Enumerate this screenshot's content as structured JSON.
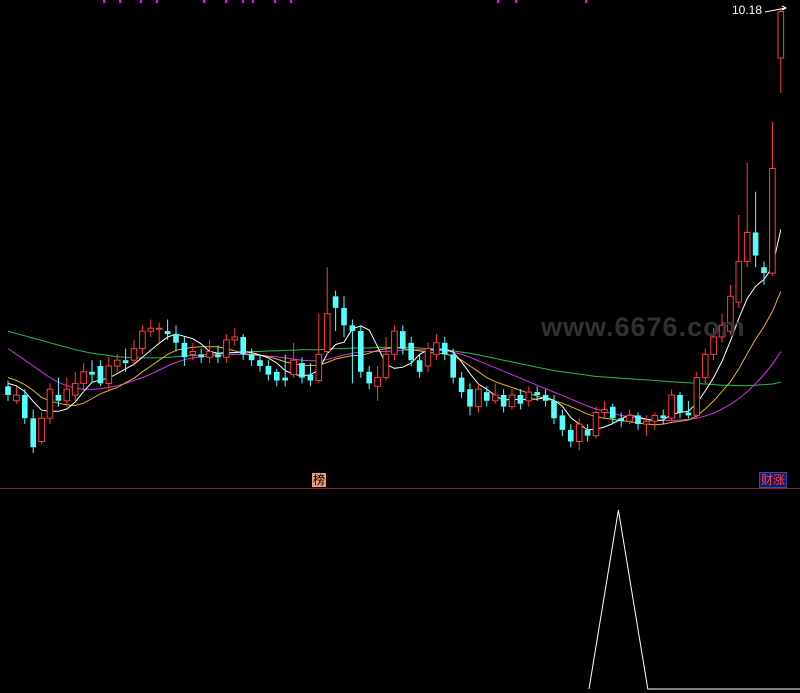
{
  "price_label": "10.18",
  "watermark": "www.6676.com",
  "tags": {
    "top_left": "榜",
    "top_right": "财涨"
  },
  "colors": {
    "background": "#000000",
    "up": "#ff3c3c",
    "down": "#54ffff",
    "ma_white": "#ffffff",
    "ma_yellow": "#e6b422",
    "ma_magenta": "#d632e6",
    "ma_green": "#2fb84f",
    "divider": "#8b1a1a",
    "top_marks": "#ff00ff"
  },
  "chart_data": [
    {
      "type": "candlestick",
      "title": "",
      "ylim": [
        2.2,
        10.6
      ],
      "y_axis_labels": [
        "10.18"
      ],
      "candles": [
        [
          3.95,
          3.8,
          4.05,
          3.7
        ],
        [
          3.7,
          3.8,
          3.95,
          3.65
        ],
        [
          3.8,
          3.4,
          3.9,
          3.3
        ],
        [
          3.4,
          2.9,
          3.55,
          2.8
        ],
        [
          3.0,
          3.4,
          3.5,
          2.95
        ],
        [
          3.4,
          3.9,
          4.0,
          3.3
        ],
        [
          3.8,
          3.7,
          4.1,
          3.6
        ],
        [
          3.7,
          3.9,
          4.1,
          3.6
        ],
        [
          3.8,
          4.0,
          4.2,
          3.7
        ],
        [
          4.0,
          4.2,
          4.35,
          3.85
        ],
        [
          4.2,
          4.15,
          4.4,
          4.0
        ],
        [
          4.3,
          4.0,
          4.4,
          3.95
        ],
        [
          4.0,
          4.3,
          4.45,
          3.9
        ],
        [
          4.3,
          4.4,
          4.5,
          4.2
        ],
        [
          4.4,
          4.35,
          4.6,
          4.2
        ],
        [
          4.4,
          4.6,
          4.75,
          4.3
        ],
        [
          4.6,
          4.9,
          5.0,
          4.5
        ],
        [
          4.9,
          4.95,
          5.1,
          4.8
        ],
        [
          4.95,
          4.95,
          5.05,
          4.7
        ],
        [
          4.9,
          4.85,
          5.1,
          4.75
        ],
        [
          4.85,
          4.7,
          5.0,
          4.55
        ],
        [
          4.7,
          4.45,
          4.8,
          4.3
        ],
        [
          4.5,
          4.55,
          4.7,
          4.4
        ],
        [
          4.5,
          4.45,
          4.6,
          4.35
        ],
        [
          4.45,
          4.55,
          4.75,
          4.35
        ],
        [
          4.5,
          4.45,
          4.65,
          4.35
        ],
        [
          4.45,
          4.75,
          4.85,
          4.35
        ],
        [
          4.75,
          4.8,
          4.95,
          4.65
        ],
        [
          4.8,
          4.5,
          4.85,
          4.4
        ],
        [
          4.5,
          4.4,
          4.6,
          4.3
        ],
        [
          4.4,
          4.3,
          4.5,
          4.2
        ],
        [
          4.3,
          4.15,
          4.4,
          4.05
        ],
        [
          4.2,
          4.05,
          4.25,
          3.95
        ],
        [
          4.1,
          4.05,
          4.5,
          3.95
        ],
        [
          4.15,
          4.4,
          4.7,
          4.1
        ],
        [
          4.35,
          4.1,
          4.45,
          4.0
        ],
        [
          4.15,
          4.05,
          4.35,
          3.95
        ],
        [
          4.05,
          4.5,
          5.2,
          4.0
        ],
        [
          4.55,
          5.2,
          6.0,
          4.5
        ],
        [
          5.5,
          5.3,
          5.6,
          4.9
        ],
        [
          5.3,
          5.0,
          5.5,
          4.8
        ],
        [
          5.0,
          4.9,
          5.1,
          4.0
        ],
        [
          4.9,
          4.2,
          5.0,
          4.1
        ],
        [
          4.2,
          4.0,
          4.3,
          3.9
        ],
        [
          3.95,
          4.1,
          4.3,
          3.7
        ],
        [
          4.1,
          4.5,
          4.8,
          4.05
        ],
        [
          4.5,
          4.9,
          5.0,
          4.4
        ],
        [
          4.9,
          4.6,
          5.0,
          4.5
        ],
        [
          4.7,
          4.4,
          4.8,
          4.3
        ],
        [
          4.4,
          4.2,
          4.5,
          4.1
        ],
        [
          4.3,
          4.6,
          4.7,
          4.2
        ],
        [
          4.5,
          4.7,
          4.85,
          4.4
        ],
        [
          4.7,
          4.5,
          4.8,
          4.4
        ],
        [
          4.5,
          4.1,
          4.6,
          4.0
        ],
        [
          4.1,
          3.85,
          4.2,
          3.75
        ],
        [
          3.9,
          3.6,
          4.0,
          3.45
        ],
        [
          3.6,
          3.9,
          4.0,
          3.5
        ],
        [
          3.85,
          3.7,
          3.95,
          3.6
        ],
        [
          3.7,
          3.8,
          4.0,
          3.65
        ],
        [
          3.8,
          3.6,
          3.9,
          3.5
        ],
        [
          3.6,
          3.8,
          3.9,
          3.55
        ],
        [
          3.8,
          3.65,
          3.9,
          3.55
        ],
        [
          3.7,
          3.85,
          3.95,
          3.6
        ],
        [
          3.85,
          3.8,
          3.95,
          3.7
        ],
        [
          3.8,
          3.7,
          3.9,
          3.6
        ],
        [
          3.7,
          3.4,
          3.8,
          3.3
        ],
        [
          3.45,
          3.2,
          3.55,
          3.1
        ],
        [
          3.2,
          3.0,
          3.3,
          2.9
        ],
        [
          3.0,
          3.3,
          3.4,
          2.85
        ],
        [
          3.2,
          3.1,
          3.3,
          3.0
        ],
        [
          3.1,
          3.5,
          3.6,
          3.05
        ],
        [
          3.5,
          3.55,
          3.7,
          3.4
        ],
        [
          3.6,
          3.4,
          3.65,
          3.3
        ],
        [
          3.4,
          3.35,
          3.5,
          3.25
        ],
        [
          3.35,
          3.45,
          3.55,
          3.3
        ],
        [
          3.45,
          3.3,
          3.5,
          3.2
        ],
        [
          3.3,
          3.35,
          3.45,
          3.1
        ],
        [
          3.35,
          3.45,
          3.5,
          3.2
        ],
        [
          3.45,
          3.4,
          3.55,
          3.3
        ],
        [
          3.4,
          3.8,
          3.9,
          3.35
        ],
        [
          3.8,
          3.5,
          3.85,
          3.4
        ],
        [
          3.5,
          3.45,
          3.7,
          3.4
        ],
        [
          3.45,
          4.1,
          4.2,
          3.4
        ],
        [
          4.1,
          4.5,
          4.6,
          4.0
        ],
        [
          4.5,
          4.8,
          4.95,
          4.4
        ],
        [
          4.8,
          5.0,
          5.2,
          4.7
        ],
        [
          4.9,
          5.5,
          5.7,
          4.85
        ],
        [
          5.4,
          6.1,
          6.9,
          5.3
        ],
        [
          6.1,
          6.6,
          7.8,
          6.0
        ],
        [
          6.6,
          6.2,
          7.3,
          6.0
        ],
        [
          6.0,
          5.9,
          6.1,
          5.7
        ],
        [
          5.9,
          7.7,
          8.5,
          5.85
        ],
        [
          9.6,
          10.4,
          10.45,
          9.0
        ]
      ],
      "ma_lines": [
        {
          "color_key": "ma_white",
          "values": [
            4.0,
            3.96,
            3.86,
            3.69,
            3.54,
            3.52,
            3.52,
            3.56,
            3.68,
            3.86,
            4.02,
            4.06,
            4.09,
            4.17,
            4.25,
            4.33,
            4.45,
            4.57,
            4.69,
            4.8,
            4.85,
            4.81,
            4.77,
            4.68,
            4.55,
            4.52,
            4.53,
            4.53,
            4.55,
            4.53,
            4.49,
            4.44,
            4.35,
            4.22,
            4.16,
            4.13,
            4.15,
            4.23,
            4.51,
            4.67,
            4.71,
            4.94,
            4.99,
            4.92,
            4.63,
            4.33,
            4.26,
            4.28,
            4.35,
            4.5,
            4.58,
            4.58,
            4.6,
            4.54,
            4.37,
            4.17,
            3.99,
            3.9,
            3.79,
            3.71,
            3.73,
            3.72,
            3.73,
            3.73,
            3.76,
            3.71,
            3.61,
            3.41,
            3.3,
            3.2,
            3.21,
            3.25,
            3.31,
            3.39,
            3.46,
            3.42,
            3.38,
            3.36,
            3.37,
            3.47,
            3.5,
            3.52,
            3.66,
            3.87,
            4.1,
            4.38,
            4.73,
            5.12,
            5.46,
            5.67,
            5.79,
            6.0,
            6.65
          ]
        },
        {
          "color_key": "ma_yellow",
          "values": [
            4.1,
            4.05,
            3.98,
            3.88,
            3.76,
            3.7,
            3.66,
            3.63,
            3.62,
            3.66,
            3.74,
            3.82,
            3.88,
            3.93,
            4.01,
            4.09,
            4.2,
            4.3,
            4.4,
            4.5,
            4.57,
            4.6,
            4.62,
            4.63,
            4.63,
            4.63,
            4.6,
            4.56,
            4.51,
            4.5,
            4.49,
            4.46,
            4.42,
            4.37,
            4.34,
            4.31,
            4.31,
            4.31,
            4.36,
            4.42,
            4.45,
            4.48,
            4.48,
            4.52,
            4.57,
            4.6,
            4.62,
            4.6,
            4.58,
            4.56,
            4.54,
            4.52,
            4.51,
            4.47,
            4.4,
            4.3,
            4.2,
            4.1,
            4.03,
            3.98,
            3.93,
            3.88,
            3.83,
            3.78,
            3.74,
            3.7,
            3.66,
            3.6,
            3.54,
            3.47,
            3.43,
            3.4,
            3.38,
            3.36,
            3.34,
            3.32,
            3.3,
            3.29,
            3.3,
            3.33,
            3.35,
            3.37,
            3.44,
            3.56,
            3.7,
            3.86,
            4.03,
            4.25,
            4.51,
            4.76,
            4.98,
            5.24,
            5.58
          ]
        },
        {
          "color_key": "ma_magenta",
          "values": [
            4.6,
            4.5,
            4.4,
            4.3,
            4.2,
            4.1,
            4.02,
            3.96,
            3.92,
            3.9,
            3.9,
            3.91,
            3.93,
            3.96,
            4.0,
            4.05,
            4.1,
            4.16,
            4.23,
            4.3,
            4.36,
            4.41,
            4.44,
            4.46,
            4.47,
            4.48,
            4.49,
            4.5,
            4.5,
            4.49,
            4.48,
            4.47,
            4.46,
            4.44,
            4.42,
            4.4,
            4.39,
            4.39,
            4.41,
            4.45,
            4.49,
            4.52,
            4.54,
            4.55,
            4.55,
            4.55,
            4.56,
            4.57,
            4.58,
            4.58,
            4.58,
            4.57,
            4.56,
            4.54,
            4.5,
            4.45,
            4.39,
            4.33,
            4.27,
            4.21,
            4.15,
            4.09,
            4.03,
            3.97,
            3.91,
            3.85,
            3.79,
            3.73,
            3.67,
            3.61,
            3.56,
            3.52,
            3.48,
            3.45,
            3.42,
            3.4,
            3.38,
            3.37,
            3.36,
            3.36,
            3.37,
            3.38,
            3.4,
            3.44,
            3.49,
            3.56,
            3.64,
            3.74,
            3.86,
            4.0,
            4.15,
            4.33,
            4.55
          ]
        },
        {
          "color_key": "ma_green",
          "values": [
            4.9,
            4.86,
            4.82,
            4.78,
            4.74,
            4.7,
            4.66,
            4.62,
            4.58,
            4.55,
            4.52,
            4.5,
            4.48,
            4.46,
            4.45,
            4.44,
            4.44,
            4.44,
            4.44,
            4.45,
            4.46,
            4.47,
            4.48,
            4.49,
            4.5,
            4.51,
            4.52,
            4.53,
            4.54,
            4.55,
            4.55,
            4.56,
            4.56,
            4.57,
            4.57,
            4.58,
            4.58,
            4.58,
            4.59,
            4.6,
            4.6,
            4.61,
            4.61,
            4.61,
            4.62,
            4.62,
            4.62,
            4.62,
            4.62,
            4.61,
            4.6,
            4.59,
            4.58,
            4.56,
            4.54,
            4.52,
            4.49,
            4.46,
            4.43,
            4.4,
            4.37,
            4.34,
            4.31,
            4.28,
            4.25,
            4.22,
            4.2,
            4.18,
            4.16,
            4.14,
            4.12,
            4.11,
            4.1,
            4.09,
            4.08,
            4.07,
            4.06,
            4.05,
            4.04,
            4.03,
            4.02,
            4.01,
            4.0,
            3.99,
            3.98,
            3.97,
            3.97,
            3.96,
            3.96,
            3.97,
            3.98,
            3.99,
            4.02
          ]
        }
      ]
    },
    {
      "type": "line",
      "title": "",
      "ylim": [
        0,
        1
      ],
      "x": [
        0.0,
        0.78,
        0.808,
        0.836,
        1.0
      ],
      "values": [
        0,
        0,
        1,
        0,
        0
      ]
    }
  ]
}
